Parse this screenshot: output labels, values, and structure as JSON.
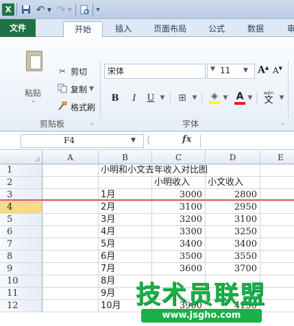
{
  "quick_access": {
    "logo_letter": "X",
    "save_icon": "save-icon",
    "undo_icon": "undo-icon",
    "redo_icon": "redo-icon",
    "print_preview_icon": "print-preview-icon"
  },
  "tabs": [
    {
      "label": "文件"
    },
    {
      "label": "开始"
    },
    {
      "label": "插入"
    },
    {
      "label": "页面布局"
    },
    {
      "label": "公式"
    },
    {
      "label": "数据"
    },
    {
      "label": "审"
    }
  ],
  "clipboard": {
    "paste_label": "粘贴",
    "cut_label": "剪切",
    "copy_label": "复制",
    "format_painter_label": "格式刷",
    "group_label": "剪贴板"
  },
  "font": {
    "name": "宋体",
    "size": "11",
    "grow_label": "A",
    "shrink_label": "A",
    "bold_label": "B",
    "italic_label": "I",
    "underline_label": "U",
    "font_color_label": "A",
    "phonetic_small": "wén",
    "phonetic_big": "文",
    "group_label": "字体",
    "fill_color": "#ffff00",
    "font_color": "#e0241b"
  },
  "formula_bar": {
    "name_box": "F4",
    "fx_label": "fx",
    "formula": ""
  },
  "grid": {
    "columns": [
      "A",
      "B",
      "C",
      "D",
      "E"
    ],
    "active_row": 4,
    "rows": [
      {
        "num": "1",
        "A": "",
        "B": "小明和小文去年收入对比图",
        "C": "",
        "D": ""
      },
      {
        "num": "2",
        "A": "",
        "B": "",
        "C": "小明收入",
        "D": "小文收入"
      },
      {
        "num": "3",
        "A": "",
        "B": "1月",
        "C": "3000",
        "D": "2800"
      },
      {
        "num": "4",
        "A": "",
        "B": "2月",
        "C": "3100",
        "D": "2950"
      },
      {
        "num": "5",
        "A": "",
        "B": "3月",
        "C": "3200",
        "D": "3100"
      },
      {
        "num": "6",
        "A": "",
        "B": "4月",
        "C": "3300",
        "D": "3250"
      },
      {
        "num": "7",
        "A": "",
        "B": "5月",
        "C": "3400",
        "D": "3400"
      },
      {
        "num": "8",
        "A": "",
        "B": "6月",
        "C": "3500",
        "D": "3550"
      },
      {
        "num": "9",
        "A": "",
        "B": "7月",
        "C": "3600",
        "D": "3700"
      },
      {
        "num": "10",
        "A": "",
        "B": "8月",
        "C": "",
        "D": ""
      },
      {
        "num": "11",
        "A": "",
        "B": "9月",
        "C": "",
        "D": ""
      },
      {
        "num": "12",
        "A": "",
        "B": "10月",
        "C": "3900",
        "D": "4150"
      }
    ]
  },
  "watermark": {
    "text": "技术员联盟",
    "url": "www.jsgho.com"
  },
  "colors": {
    "file_tab": "#1f7245",
    "active_row_header": "#f9d98a",
    "watermark_green": "#19b04a"
  }
}
